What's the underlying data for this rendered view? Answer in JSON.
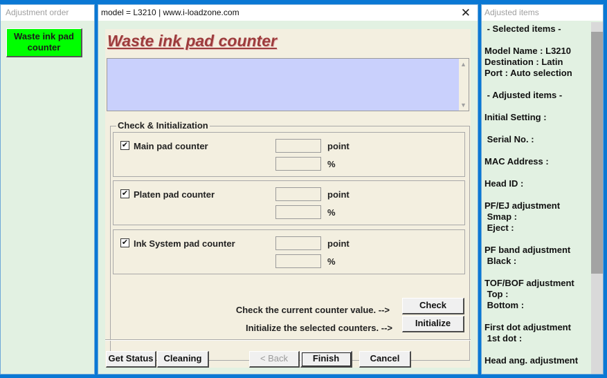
{
  "left_window": {
    "title": "Adjustment order",
    "item_label_line1": "Waste ink pad",
    "item_label_line2": "counter"
  },
  "main_window": {
    "title": "model = L3210 | www.i-loadzone.com",
    "close_glyph": "✕",
    "heading": "Waste ink pad counter",
    "group_label": "Check & Initialization",
    "counters": [
      {
        "label": "Main pad counter",
        "checked": true,
        "point_value": "",
        "percent_value": "",
        "point_unit": "point",
        "percent_unit": "%"
      },
      {
        "label": "Platen pad counter",
        "checked": true,
        "point_value": "",
        "percent_value": "",
        "point_unit": "point",
        "percent_unit": "%"
      },
      {
        "label": "Ink System pad counter",
        "checked": true,
        "point_value": "",
        "percent_value": "",
        "point_unit": "point",
        "percent_unit": "%"
      }
    ],
    "check_caption": "Check the current counter value. -->",
    "check_button": "Check",
    "init_caption": "Initialize the selected counters. -->",
    "init_button": "Initialize",
    "footer_buttons": {
      "get_status": "Get Status",
      "cleaning": "Cleaning",
      "back": "< Back",
      "finish": "Finish",
      "cancel": "Cancel"
    }
  },
  "right_window": {
    "title": "Adjusted items",
    "lines": [
      " - Selected items -",
      "",
      "Model Name : L3210",
      "Destination : Latin",
      "Port : Auto selection",
      "",
      " - Adjusted items -",
      "",
      "Initial Setting :",
      "",
      " Serial No. :",
      "",
      "MAC Address :",
      "",
      "Head ID :",
      "",
      "PF/EJ adjustment",
      " Smap :",
      " Eject :",
      "",
      "PF band adjustment",
      " Black :",
      "",
      "TOF/BOF adjustment",
      " Top :",
      " Bottom :",
      "",
      "First dot adjustment",
      " 1st dot :",
      "",
      "Head ang. adjustment"
    ]
  },
  "colors": {
    "desktop": "#0a78d4",
    "panel": "#e2f1e2",
    "content": "#f3efe0",
    "message_box": "#c9d0fc",
    "heading": "#9c3c3c",
    "active_item": "#00ff00"
  }
}
